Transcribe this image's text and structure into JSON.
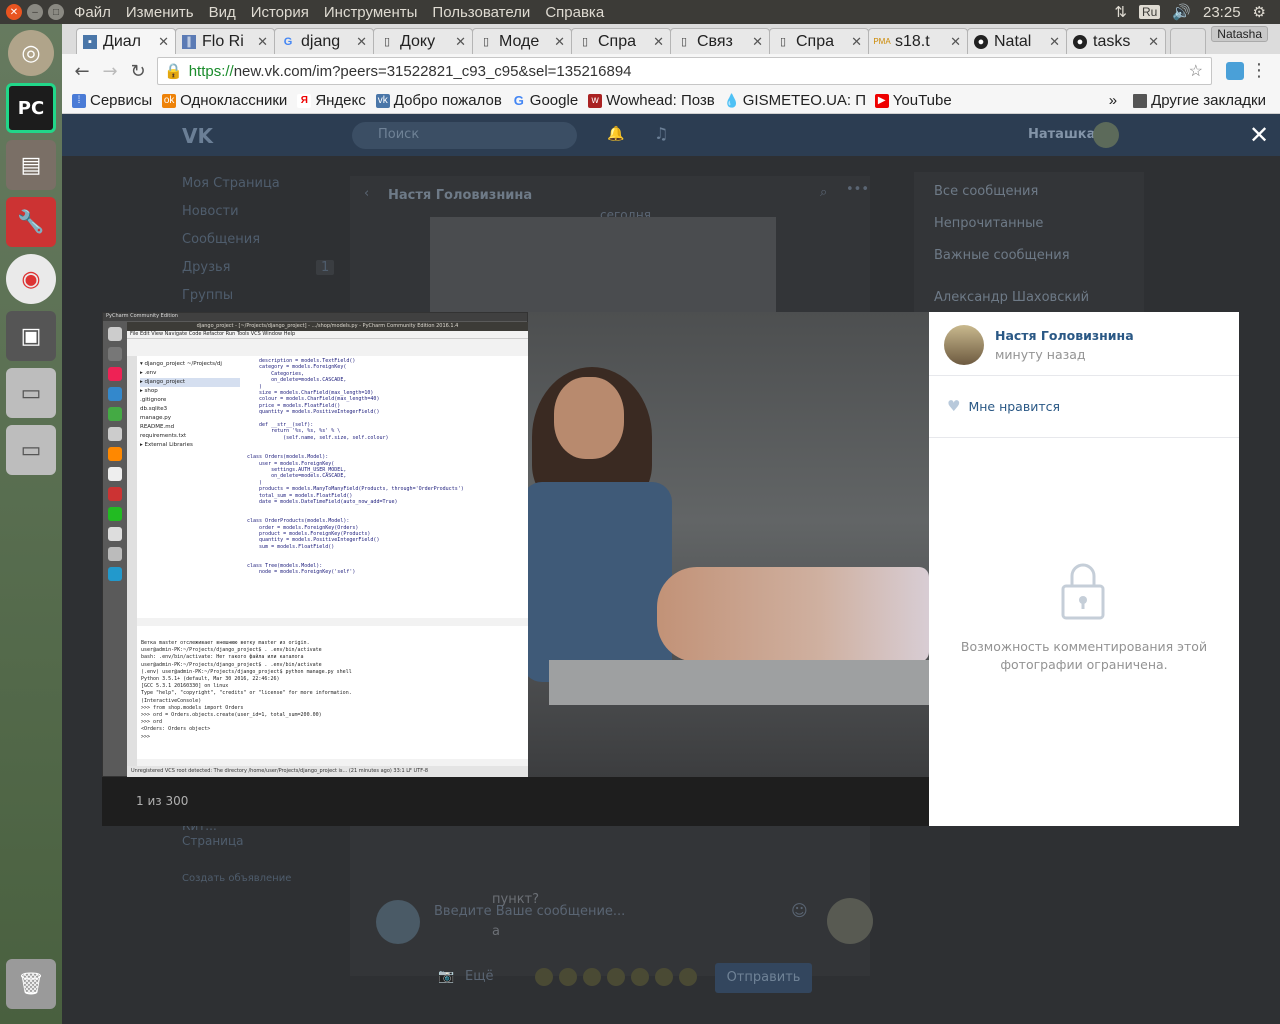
{
  "system": {
    "menu": [
      "Файл",
      "Изменить",
      "Вид",
      "История",
      "Инструменты",
      "Пользователи",
      "Справка"
    ],
    "lang": "Ru",
    "time": "23:25"
  },
  "browser": {
    "tabs": [
      {
        "label": "Диал",
        "icon": "vk-icon"
      },
      {
        "label": "Flo Ri",
        "icon": "bars-icon"
      },
      {
        "label": "djang",
        "icon": "google-icon"
      },
      {
        "label": "Доку",
        "icon": "doc-icon"
      },
      {
        "label": "Моде",
        "icon": "doc-icon"
      },
      {
        "label": "Спра",
        "icon": "doc-icon"
      },
      {
        "label": "Связ",
        "icon": "doc-icon"
      },
      {
        "label": "Спра",
        "icon": "doc-icon"
      },
      {
        "label": "s18.t",
        "icon": "rma-icon"
      },
      {
        "label": "Natal",
        "icon": "github-icon"
      },
      {
        "label": "tasks",
        "icon": "github-icon"
      }
    ],
    "profile": "Natasha",
    "url_scheme": "https://",
    "url_rest": "new.vk.com/im?peers=31522821_c93_c95&sel=135216894",
    "bookmarks": [
      "Сервисы",
      "Одноклассники",
      "Яндекс",
      "Добро пожалов",
      "Google",
      "Wowhead: Позв",
      "GISMETEO.UA: П",
      "YouTube"
    ],
    "bookmarks_more": "»",
    "other_bookmarks": "Другие закладки"
  },
  "vk": {
    "search_placeholder": "Поиск",
    "username": "Наташка",
    "left_menu": [
      "Моя Страница",
      "Новости",
      "Сообщения",
      "Друзья",
      "Группы"
    ],
    "friends_count": "1",
    "conv_title": "Настя Головизнина",
    "date_label": "сегодня",
    "right_menu": [
      "Все сообщения",
      "Непрочитанные",
      "Важные сообщения",
      "Александр Шаховский"
    ],
    "below_left": [
      "Кит...",
      "Страница",
      "Создать объявление"
    ],
    "messages": [
      "пункт?",
      "а"
    ],
    "composer_placeholder": "Введите Ваше сообщение...",
    "more_label": "Ещё",
    "send_label": "Отправить"
  },
  "viewer": {
    "counter": "1 из 300",
    "author": "Настя Головизнина",
    "time": "минуту назад",
    "like_label": "Мне нравится",
    "comments_locked": "Возможность комментирования этой фотографии ограничена."
  },
  "ide": {
    "top": "PyCharm Community Edition",
    "title": "django_project - [~/Projects/django_project] - .../shop/models.py - PyCharm Community Edition 2016.1.4",
    "menu": "File  Edit  View  Navigate  Code  Refactor  Run  Tools  VCS  Window  Help",
    "tree": [
      "▾ django_project ~/Projects/dj",
      "  ▸ .env",
      "  ▸ django_project",
      "  ▸ shop",
      "    .gitignore",
      "    db.sqlite3",
      "    manage.py",
      "    README.md",
      "    requirements.txt",
      "▸ External Libraries"
    ],
    "code": "    description = models.TextField()\n    category = models.ForeignKey(\n        Categories,\n        on_delete=models.CASCADE,\n    )\n    size = models.CharField(max_length=10)\n    colour = models.CharField(max_length=40)\n    price = models.FloatField()\n    quantity = models.PositiveIntegerField()\n\n    def __str__(self):\n        return '%s, %s, %s' % \\\n            (self.name, self.size, self.colour)\n\n\nclass Orders(models.Model):\n    user = models.ForeignKey(\n        settings.AUTH_USER_MODEL,\n        on_delete=models.CASCADE,\n    )\n    products = models.ManyToManyField(Products, through='OrderProducts')\n    total_sum = models.FloatField()\n    date = models.DateTimeField(auto_now_add=True)\n\n\nclass OrderProducts(models.Model):\n    order = models.ForeignKey(Orders)\n    product = models.ForeignKey(Products)\n    quantity = models.PositiveIntegerField()\n    sum = models.FloatField()\n\n\nclass Tree(models.Model):\n    node = models.ForeignKey('self')",
    "terminal": "Ветка master отслеживает внешнюю ветку master из origin.\nuser@admin-PK:~/Projects/django_project$ . .env/bin/activate\nbash: .env/bin/activate: Нет такого файла или каталога\nuser@admin-PK:~/Projects/django_project$ . .env/bin/activate\n(.env) user@admin-PK:~/Projects/django_project$ python manage.py shell\nPython 3.5.1+ (default, Mar 30 2016, 22:46:26)\n[GCC 5.3.1 20160330] on linux\nType \"help\", \"copyright\", \"credits\" or \"license\" for more information.\n(InteractiveConsole)\n>>> from shop.models import Orders\n>>> ord = Orders.objects.create(user_id=1, total_sum=200.00)\n>>> ord\n<Orders: Orders object>\n>>>",
    "status": "Unregistered VCS root detected: The directory /home/user/Projects/django_project is... (21 minutes ago)  33:1  LF  UTF-8"
  }
}
